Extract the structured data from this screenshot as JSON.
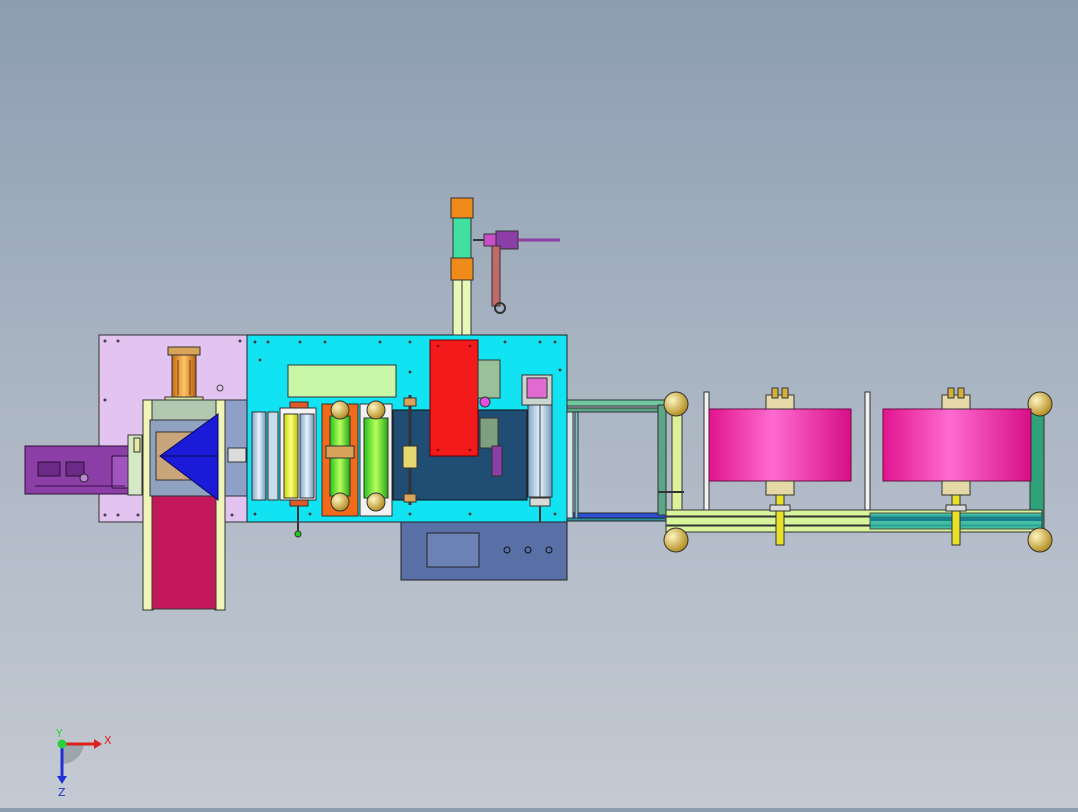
{
  "triad": {
    "x_label": "X",
    "y_label": "Y",
    "z_label": "Z",
    "x_color": "#e0201b",
    "y_color": "#2bd13a",
    "z_color": "#2030d8"
  },
  "palette": {
    "frame_pink": "#e3c3ef",
    "bed_cyan": "#11e3f2",
    "dark_bay": "#1f4d73",
    "control_box": "#5970a6",
    "red_block": "#f21a1a",
    "roll_magenta": "#f02aa8",
    "rail_lime": "#d9f59c",
    "feeder_purple": "#8a3ea6",
    "gold": "#d4b23a"
  }
}
